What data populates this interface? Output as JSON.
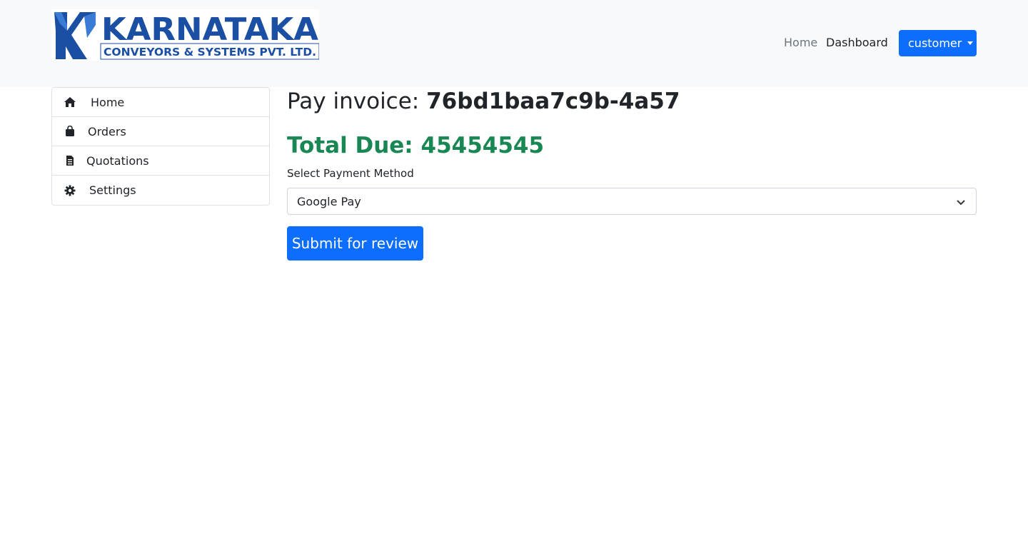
{
  "brand": {
    "name": "KARNATAKA",
    "tagline": "CONVEYORS & SYSTEMS PVT. LTD."
  },
  "nav": {
    "home": "Home",
    "dashboard": "Dashboard",
    "user_menu": "customer"
  },
  "sidebar": {
    "items": [
      {
        "label": "Home",
        "icon": "home-icon"
      },
      {
        "label": "Orders",
        "icon": "shopping-bag-icon"
      },
      {
        "label": "Quotations",
        "icon": "document-icon"
      },
      {
        "label": "Settings",
        "icon": "gear-icon"
      }
    ]
  },
  "main": {
    "title_prefix": "Pay invoice:",
    "invoice_id": "76bd1baa7c9b-4a57",
    "total_due_label": "Total Due:",
    "total_due_value": "45454545",
    "payment_label": "Select Payment Method",
    "payment_selected": "Google Pay",
    "submit_label": "Submit for review"
  },
  "colors": {
    "primary": "#0d6efd",
    "success": "#198754",
    "navbar_bg": "#f8f9fa",
    "logo_blue": "#1a4fa3"
  }
}
